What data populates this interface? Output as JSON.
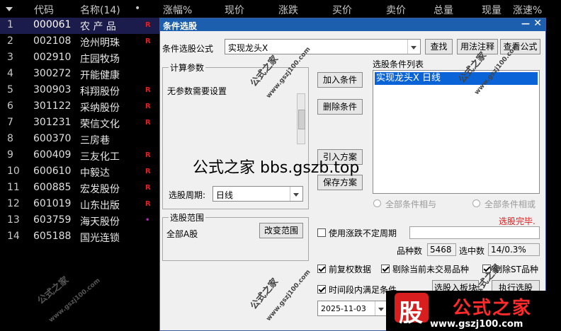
{
  "header": {
    "code": "代码",
    "name": "名称(14)",
    "dot": "•",
    "change_pct": "涨幅%",
    "price": "现价",
    "change": "涨跌",
    "bid": "买价",
    "ask": "卖价",
    "volume": "总量",
    "cur_vol": "现量",
    "speed": "涨速%"
  },
  "stocks": [
    {
      "idx": "1",
      "code": "000061",
      "name": "农 产 品",
      "flag": "R"
    },
    {
      "idx": "2",
      "code": "002108",
      "name": "沧州明珠",
      "flag": "R"
    },
    {
      "idx": "3",
      "code": "002910",
      "name": "庄园牧场",
      "flag": ""
    },
    {
      "idx": "4",
      "code": "300272",
      "name": "开能健康",
      "flag": ""
    },
    {
      "idx": "5",
      "code": "300903",
      "name": "科翔股份",
      "flag": "R"
    },
    {
      "idx": "6",
      "code": "301122",
      "name": "采纳股份",
      "flag": "R"
    },
    {
      "idx": "7",
      "code": "301231",
      "name": "荣信文化",
      "flag": "R"
    },
    {
      "idx": "8",
      "code": "600370",
      "name": "三房巷",
      "flag": ""
    },
    {
      "idx": "9",
      "code": "600409",
      "name": "三友化工",
      "flag": "R"
    },
    {
      "idx": "10",
      "code": "600610",
      "name": "中毅达",
      "flag": "R"
    },
    {
      "idx": "11",
      "code": "600885",
      "name": "宏发股份",
      "flag": "R"
    },
    {
      "idx": "12",
      "code": "601019",
      "name": "山东出版",
      "flag": "R"
    },
    {
      "idx": "13",
      "code": "603759",
      "name": "海天股份",
      "flag": "•"
    },
    {
      "idx": "14",
      "code": "605188",
      "name": "国光连锁",
      "flag": ""
    }
  ],
  "dialog": {
    "title": "条件选股",
    "min": "—",
    "close": "✕",
    "formula_label": "条件选股公式",
    "formula_value": "实现龙头X",
    "find_btn": "查找",
    "usage_btn": "用法注释",
    "view_btn": "查看公式",
    "params_group": "计算参数",
    "params_text": "无参数需要设置",
    "period_label": "选股周期:",
    "period_value": "日线",
    "add_btn": "加入条件",
    "delete_btn": "删除条件",
    "import_btn": "引入方案",
    "save_btn": "保存方案",
    "cond_list_label": "选股条件列表",
    "cond_item": "实现龙头X  日线",
    "radio_and": "全部条件相与",
    "radio_or": "全部条件相或",
    "status": "选股完毕.",
    "range_group": "选股范围",
    "range_value": "全部A股",
    "change_range_btn": "改变范围",
    "use_period_label": "使用涨跌不定周期",
    "count_label": "品种数",
    "count_value": "5468",
    "selected_label": "选中数",
    "selected_value": "14/0.3%",
    "fq_label": "前复权数据",
    "exclude_untraded_label": "剔除当前未交易品种",
    "exclude_st_label": "剔除ST品种",
    "period_cond_label": "时间段内满足条件",
    "date_value": "2025-11-03",
    "to_board_btn": "选股入板块",
    "exec_btn": "执行选股"
  },
  "watermark": {
    "site": "公式之家 bbs.gszb.top",
    "brand": "公式之家",
    "domain": "www.gszj100.com",
    "gu": "股"
  },
  "colors": {
    "title_bar": "#1b5fae",
    "selection": "#0a64d8",
    "status": "#e02020",
    "flag": "#e02020"
  }
}
